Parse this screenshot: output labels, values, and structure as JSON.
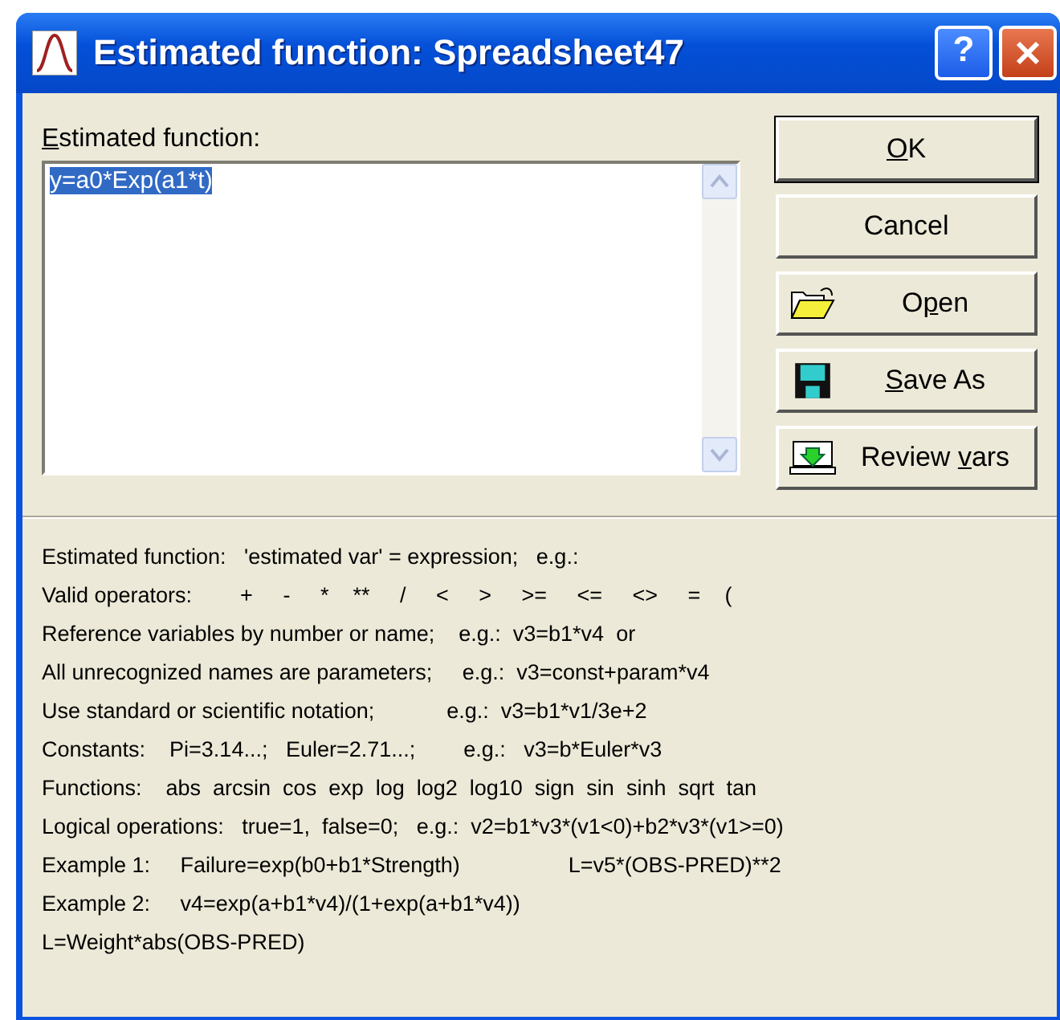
{
  "window": {
    "title": "Estimated function: Spreadsheet47"
  },
  "title_buttons": [
    {
      "kind": "help",
      "label": "?"
    },
    {
      "kind": "close"
    }
  ],
  "function_field": {
    "label": {
      "key": "E",
      "post": "stimated function:"
    },
    "value": "y=a0*Exp(a1*t)",
    "selected": true
  },
  "buttons": [
    {
      "kind": "plain",
      "key": "O",
      "post": "K",
      "default": true
    },
    {
      "kind": "plain",
      "pre": "Cancel",
      "default": false
    },
    {
      "kind": "open",
      "pre": "O",
      "key": "p",
      "post": "en",
      "default": false
    },
    {
      "kind": "save",
      "key": "S",
      "post": "ave As",
      "default": false
    },
    {
      "kind": "review",
      "pre": "Review ",
      "key": "v",
      "post": "ars",
      "default": false
    }
  ],
  "help_lines": [
    "Estimated function:   'estimated var' = expression;   e.g.:",
    "Valid operators:        +     -     *    **     /     <     >     >=     <=     <>     =    (",
    "Reference variables by number or name;    e.g.:  v3=b1*v4  or",
    "All unrecognized names are parameters;     e.g.:  v3=const+param*v4",
    "Use standard or scientific notation;            e.g.:  v3=b1*v1/3e+2",
    "Constants:    Pi=3.14...;   Euler=2.71...;        e.g.:   v3=b*Euler*v3",
    "Functions:    abs  arcsin  cos  exp  log  log2  log10  sign  sin  sinh  sqrt  tan",
    "Logical operations:   true=1,  false=0;   e.g.:  v2=b1*v3*(v1<0)+b2*v3*(v1>=0)",
    "Example 1:     Failure=exp(b0+b1*Strength)                  L=v5*(OBS-PRED)**2",
    "Example 2:     v4=exp(a+b1*v4)/(1+exp(a+b1*v4))",
    "L=Weight*abs(OBS-PRED)"
  ]
}
